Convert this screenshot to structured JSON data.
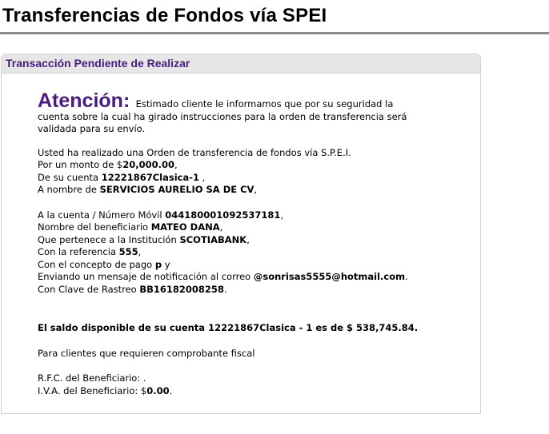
{
  "page": {
    "title": "Transferencias de Fondos vía SPEI"
  },
  "panel": {
    "header": "Transacción Pendiente de Realizar"
  },
  "notice": {
    "attention": "Atención:",
    "message_line1": "Estimado cliente le informamos que por su seguridad la",
    "message_line2": "cuenta sobre la cual ha girado instrucciones para la orden de transferencia será",
    "message_line3": "validada para su envío."
  },
  "order": {
    "intro": "Usted ha realizado una Orden de transferencia de fondos vía S.P.E.I.",
    "amount_prefix": "Por un monto de $",
    "amount": "20,000.00",
    "amount_suffix": ",",
    "from_account_prefix": "De su cuenta ",
    "from_account": "12221867Clasica-1",
    "from_account_suffix": " ,",
    "holder_prefix": "A nombre de ",
    "holder": "SERVICIOS AURELIO SA DE CV",
    "holder_suffix": ","
  },
  "destination": {
    "account_prefix": "A la cuenta / Número Móvil ",
    "account": "044180001092537181",
    "account_suffix": ",",
    "beneficiary_prefix": "Nombre del beneficiario ",
    "beneficiary": "MATEO DANA",
    "beneficiary_suffix": ",",
    "institution_prefix": "Que pertenece a la Institución ",
    "institution": "SCOTIABANK",
    "institution_suffix": ",",
    "reference_prefix": "Con la referencia ",
    "reference": "555",
    "reference_suffix": ",",
    "concept_prefix": "Con el concepto de pago ",
    "concept": "p",
    "concept_suffix": " y",
    "email_prefix": "Enviando un mensaje de notificación al correo ",
    "email": "@sonrisas5555@hotmail.com",
    "email_suffix": ".",
    "tracking_prefix": "Con Clave de Rastreo ",
    "tracking": "BB16182008258",
    "tracking_suffix": "."
  },
  "balance": {
    "text": "El saldo disponible de su cuenta 12221867Clasica - 1 es de $ 538,745.84."
  },
  "fiscal": {
    "heading": "Para clientes que requieren comprobante fiscal",
    "rfc_label": "R.F.C. del Beneficiario: ",
    "rfc_value": ".",
    "iva_label": "I.V.A. del Beneficiario: $",
    "iva_value": "0.00",
    "iva_suffix": "."
  },
  "colors": {
    "accent": "#4b1a87",
    "header_bg": "#e6e6e6",
    "rule": "#8c8c8c"
  }
}
